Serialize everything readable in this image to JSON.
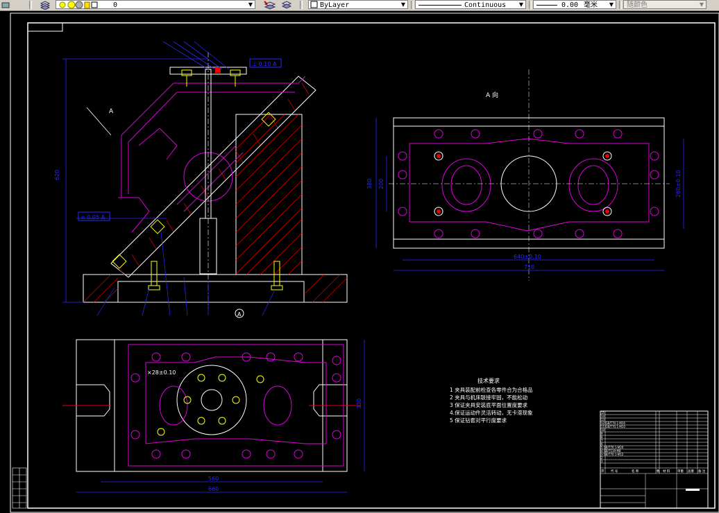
{
  "toolbar": {
    "layer_value": "0",
    "color_value": "ByLayer",
    "linetype_value": "Continuous",
    "lineweight_value": "0.00",
    "lineweight_unit": "毫米",
    "plotstyle_value": "随颜色"
  },
  "drawing": {
    "view_a_label": "A",
    "view_a_title": "A 向",
    "dim_height": "620",
    "dim_width_top": "640±0.10",
    "dim_width_outer": "710",
    "dim_right_v": "260±0.10",
    "dim_left_v1": "380",
    "dim_left_v2": "200",
    "dim_bottom_inner": "560",
    "dim_bottom_outer": "660",
    "dim_bottom_right": "330",
    "tol_box_1": "⊥ 0.10 A",
    "tol_box_2": "= 0.05 A",
    "datum_bottom": "A",
    "dim_hole": "×28±0.10",
    "tech_req_title": "技术要求",
    "tech_req": [
      "1  夹具装配前检查各零件合为合格品",
      "2  夹具与机床联接牢固，不能松动",
      "3  保证夹具安装底平面位置度要求",
      "4.保证运动件灵活转动，无卡滞现象",
      "5  保证钻套对平行度要求"
    ]
  },
  "titleblock": {
    "header": [
      "序",
      "代 号",
      "名 称",
      "数",
      "材 料",
      "单重",
      "总重",
      "备 注"
    ],
    "rows": [
      "15",
      "14",
      "13",
      "12 GB/T70.1-M16",
      "11 GB/T70.1-M10",
      "10",
      "9",
      "8",
      "7",
      "6",
      "5 GB/T70.1-M20",
      "4 GB/T119-M8",
      "3 GB/T70.1-M12",
      "2",
      "1"
    ]
  }
}
